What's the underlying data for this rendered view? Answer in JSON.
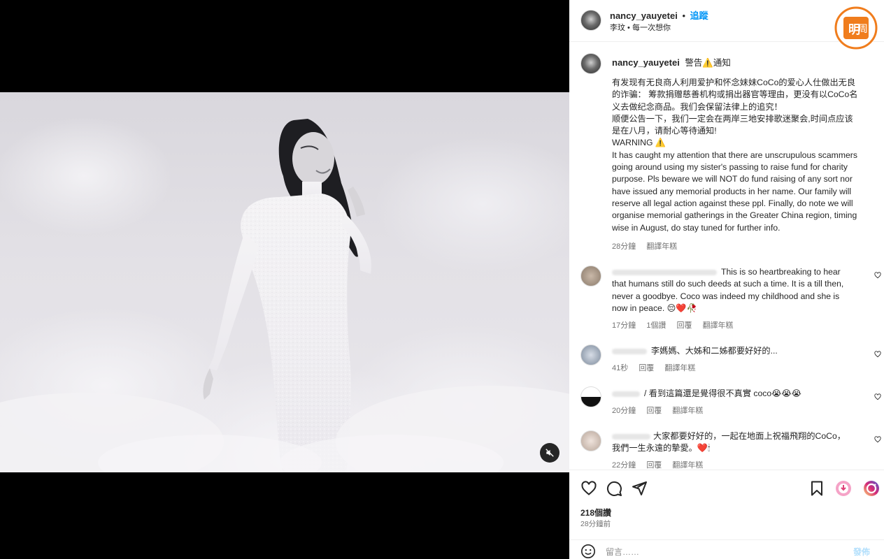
{
  "post": {
    "author": "nancy_yauyetei",
    "follow_sep": "•",
    "follow_label": "追蹤",
    "music_label": "李玟 • 每一次想你",
    "caption_title": "警告⚠️通知",
    "caption_lines": [
      "有发现有无良商人利用爱护和怀念妹妹CoCo的爱心人仕做出无良",
      "的诈骗： 筹款捐赠慈善机构或捐出器官等理由，更没有以CoCo名",
      "义去做纪念商品。我们会保留法律上的追究！",
      "顺便公告一下，我们一定会在两岸三地安排歌迷聚会,时间点应该",
      "是在八月，请耐心等待通知!",
      "WARNING ⚠️",
      "It has caught my attention that there are unscrupulous scammers",
      "going around using my sister's passing to raise fund for charity",
      "purpose. Pls beware we will NOT do fund raising of any sort nor",
      "have issued any memorial products in her name. Our family will",
      "reserve all legal action against these ppl. Finally, do note we will",
      "organise memorial gatherings in the Greater China region, timing",
      "wise in August, do stay tuned for further info."
    ],
    "caption_time": "28分鐘",
    "caption_translate": "翻譯年糕",
    "likes": "218個讚",
    "posted": "28分鐘前",
    "comment_placeholder": "留言……",
    "post_button": "發佈"
  },
  "comments": [
    {
      "lines": [
        "This is so heartbreaking to hear",
        "that humans still do such deeds at such a time. It is a till then,",
        "never a goodbye. Coco was indeed my childhood and she is",
        "now in peace. 😔❤️🥀"
      ],
      "time": "17分鐘",
      "likes": "1個讚",
      "reply": "回覆",
      "translate": "翻譯年糕"
    },
    {
      "lines": [
        "李媽媽、大姊和二姊都要好好的..."
      ],
      "time": "41秒",
      "reply": "回覆",
      "translate": "翻譯年糕"
    },
    {
      "lines": [
        "/ 看到這篇還是覺得很不真實 coco😭😭😭"
      ],
      "time": "20分鐘",
      "reply": "回覆",
      "translate": "翻譯年糕"
    },
    {
      "lines": [
        "大家都要好好的，一起在地面上祝福飛翔的CoCo，",
        "我們一生永遠的摯愛。❤️🕯"
      ],
      "time": "22分鐘",
      "reply": "回覆",
      "translate": "翻譯年糕"
    }
  ],
  "brand_logo": {
    "text_left": "明",
    "text_right": "周",
    "color": "#f07d1d"
  },
  "icons": {
    "mute": "speaker-muted-icon",
    "like": "heart-icon",
    "comment": "speech-bubble-icon",
    "share": "paper-plane-icon",
    "save": "bookmark-icon",
    "emoji": "smiley-icon"
  }
}
